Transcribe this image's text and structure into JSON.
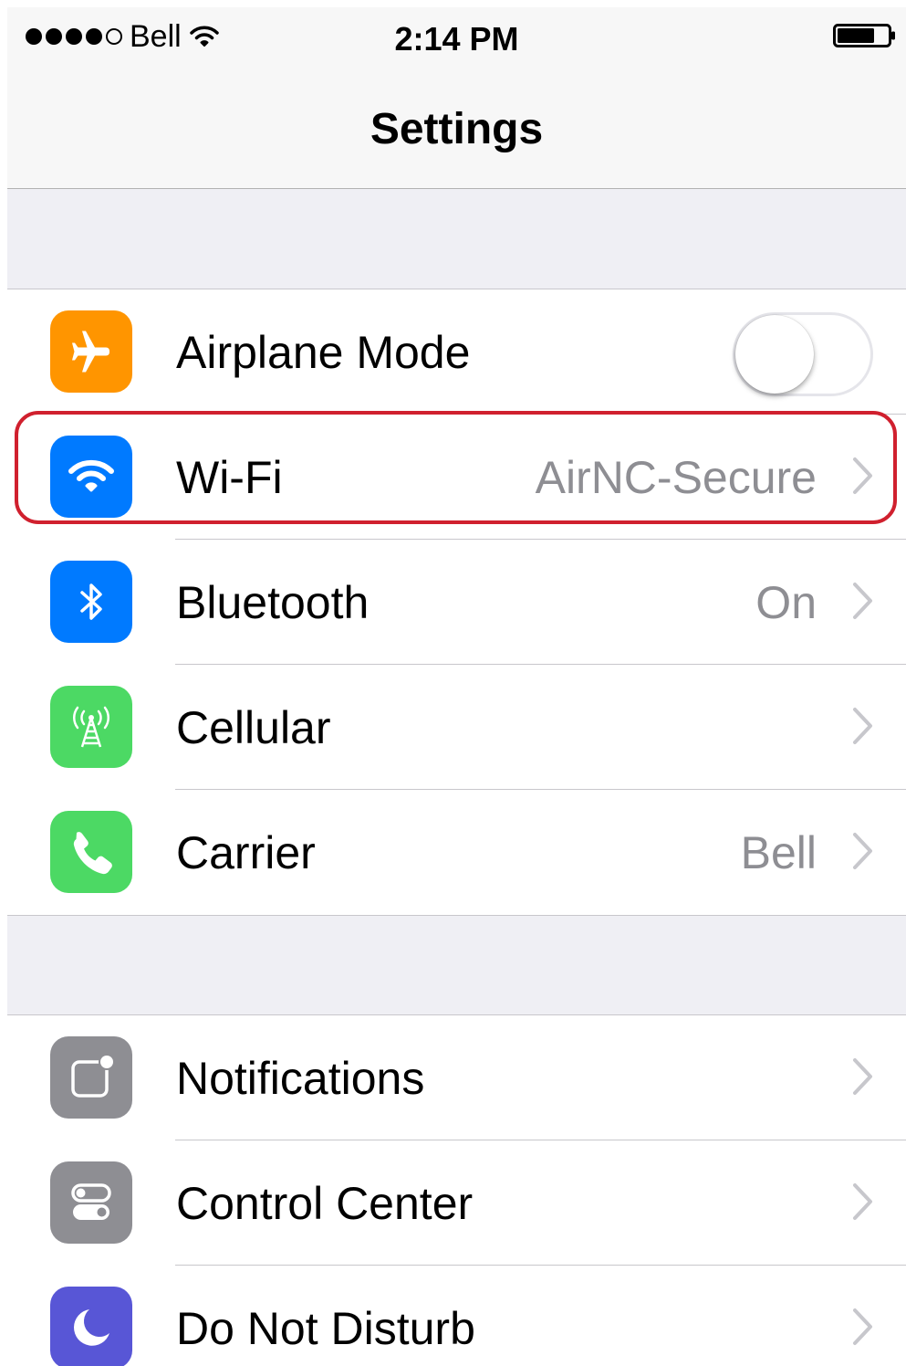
{
  "status_bar": {
    "signal_icon": "signal-dots-icon",
    "carrier": "Bell",
    "wifi_icon": "wifi-icon",
    "time": "2:14 PM",
    "battery_icon": "battery-icon"
  },
  "nav": {
    "title": "Settings"
  },
  "groups": [
    {
      "rows": [
        {
          "label": "Airplane Mode",
          "icon": "airplane-icon",
          "icon_color": "#ff9500",
          "control": "toggle",
          "toggle_on": false
        },
        {
          "label": "Wi-Fi",
          "icon": "wifi-icon",
          "icon_color": "#007aff",
          "value": "AirNC-Secure",
          "chevron": true,
          "highlighted": true
        },
        {
          "label": "Bluetooth",
          "icon": "bluetooth-icon",
          "icon_color": "#007aff",
          "value": "On",
          "chevron": true
        },
        {
          "label": "Cellular",
          "icon": "cellular-antenna-icon",
          "icon_color": "#4cd964",
          "chevron": true
        },
        {
          "label": "Carrier",
          "icon": "phone-icon",
          "icon_color": "#4cd964",
          "value": "Bell",
          "chevron": true
        }
      ]
    },
    {
      "rows": [
        {
          "label": "Notifications",
          "icon": "notifications-icon",
          "icon_color": "#8e8e93",
          "chevron": true
        },
        {
          "label": "Control Center",
          "icon": "control-center-icon",
          "icon_color": "#8e8e93",
          "chevron": true
        },
        {
          "label": "Do Not Disturb",
          "icon": "moon-icon",
          "icon_color": "#5856d6",
          "chevron": true
        }
      ]
    }
  ],
  "colors": {
    "highlight": "#d0202e",
    "value_text": "#8e8e93",
    "background": "#efeff4"
  }
}
